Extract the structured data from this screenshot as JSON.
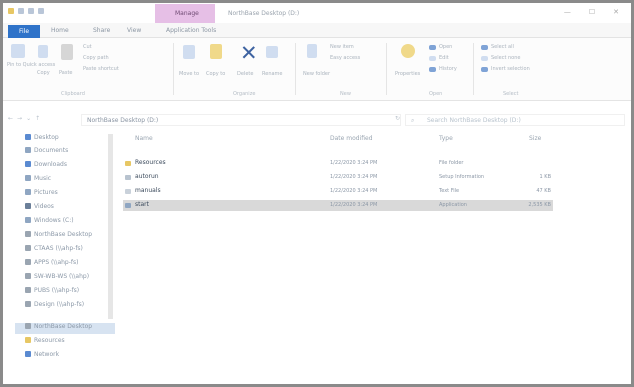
{
  "titlebar": {
    "contextual_tab": "Manage",
    "window_title": "NorthBase Desktop (D:)",
    "controls": [
      "—",
      "☐",
      "✕"
    ]
  },
  "ribbon_tabs": {
    "file": "File",
    "home": "Home",
    "share": "Share",
    "view": "View",
    "application_tools": "Application Tools"
  },
  "ribbon": {
    "groups": [
      "Clipboard",
      "Organize",
      "New",
      "Open",
      "Select"
    ],
    "clipboard_items": [
      "Pin to Quick access",
      "Copy",
      "Paste",
      "Cut",
      "Copy path",
      "Paste shortcut"
    ],
    "organize_items": [
      "Move to",
      "Copy to",
      "Delete",
      "Rename"
    ],
    "new_items": [
      "New folder",
      "New item",
      "Easy access"
    ],
    "open_items": [
      "Properties",
      "Open",
      "Edit",
      "History"
    ],
    "select_items": [
      "Select all",
      "Select none",
      "Invert selection"
    ]
  },
  "address": {
    "breadcrumb": "NorthBase Desktop (D:)",
    "search_placeholder": "Search NorthBase Desktop (D:)"
  },
  "nav": {
    "items": [
      {
        "label": "Desktop",
        "color": "#5a8ad1"
      },
      {
        "label": "Documents",
        "color": "#8fa6c2"
      },
      {
        "label": "Downloads",
        "color": "#5a8ad1"
      },
      {
        "label": "Music",
        "color": "#8fa6c2"
      },
      {
        "label": "Pictures",
        "color": "#8fa6c2"
      },
      {
        "label": "Videos",
        "color": "#6b7f99"
      },
      {
        "label": "Windows (C:)",
        "color": "#8fa6c2"
      },
      {
        "label": "NorthBase Desktop",
        "color": "#9aa5b1"
      },
      {
        "label": "CTAAS (\\\\ahp-fs)",
        "color": "#9aa5b1"
      },
      {
        "label": "APPS (\\\\ahp-fs)",
        "color": "#9aa5b1"
      },
      {
        "label": "SW-WB-WS (\\\\ahp)",
        "color": "#9aa5b1"
      },
      {
        "label": "PUBS (\\\\ahp-fs)",
        "color": "#9aa5b1"
      },
      {
        "label": "Design (\\\\ahp-fs)",
        "color": "#9aa5b1"
      },
      {
        "label": "NorthBase Desktop",
        "color": "#9aa5b1"
      },
      {
        "label": "Resources",
        "color": "#e7c764"
      },
      {
        "label": "Network",
        "color": "#5a8ad1"
      }
    ]
  },
  "columns": {
    "name": "Name",
    "date": "Date modified",
    "type": "Type",
    "size": "Size"
  },
  "files": [
    {
      "name": "Resources",
      "date": "1/22/2020 3:24 PM",
      "type": "File folder",
      "size": "",
      "icon": "folder-icon",
      "color": "#e7c764"
    },
    {
      "name": "autorun",
      "date": "1/22/2020 3:24 PM",
      "type": "Setup Information",
      "size": "1 KB",
      "icon": "setup-file-icon",
      "color": "#b8c3cf"
    },
    {
      "name": "manuals",
      "date": "1/22/2020 3:24 PM",
      "type": "Text File",
      "size": "47 KB",
      "icon": "text-file-icon",
      "color": "#c9d1da"
    },
    {
      "name": "start",
      "date": "1/22/2020 3:24 PM",
      "type": "Application",
      "size": "2,535 KB",
      "icon": "app-icon",
      "color": "#8fa6c2"
    }
  ]
}
